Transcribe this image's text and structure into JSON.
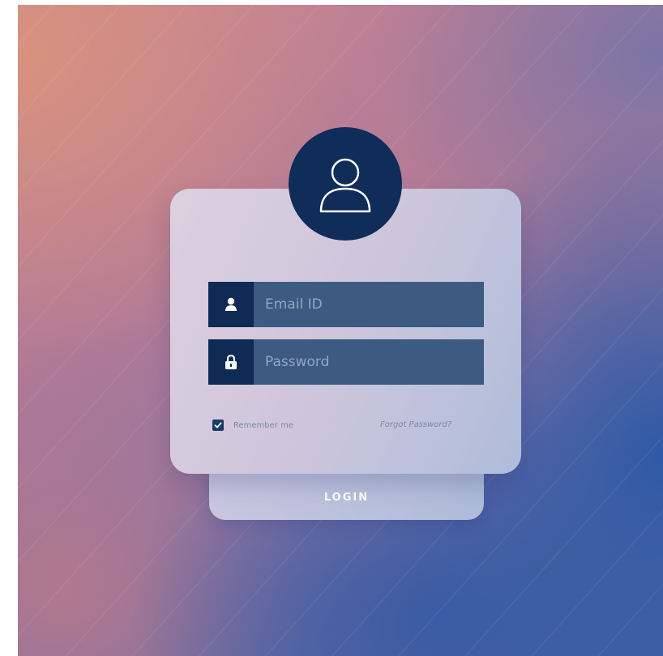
{
  "login_form": {
    "email_placeholder": "Email ID",
    "password_placeholder": "Password",
    "remember_label": "Remember me",
    "remember_checked": true,
    "forgot_link": "Forgot Password?",
    "login_button": "LOGIN"
  },
  "icons": {
    "avatar": "user-outline-icon",
    "email_field": "user-icon",
    "password_field": "lock-icon",
    "remember": "check-icon"
  },
  "colors": {
    "navy": "#102c59",
    "input_background": "#3d5a82",
    "input_placeholder": "#8fa6c4",
    "muted_text": "#7d87a6"
  }
}
